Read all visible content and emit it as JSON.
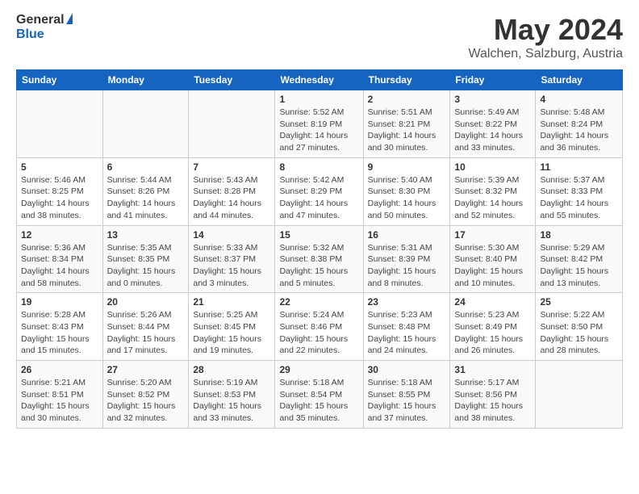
{
  "logo": {
    "general": "General",
    "blue": "Blue"
  },
  "title": "May 2024",
  "location": "Walchen, Salzburg, Austria",
  "weekdays": [
    "Sunday",
    "Monday",
    "Tuesday",
    "Wednesday",
    "Thursday",
    "Friday",
    "Saturday"
  ],
  "weeks": [
    [
      {
        "day": "",
        "info": ""
      },
      {
        "day": "",
        "info": ""
      },
      {
        "day": "",
        "info": ""
      },
      {
        "day": "1",
        "info": "Sunrise: 5:52 AM\nSunset: 8:19 PM\nDaylight: 14 hours and 27 minutes."
      },
      {
        "day": "2",
        "info": "Sunrise: 5:51 AM\nSunset: 8:21 PM\nDaylight: 14 hours and 30 minutes."
      },
      {
        "day": "3",
        "info": "Sunrise: 5:49 AM\nSunset: 8:22 PM\nDaylight: 14 hours and 33 minutes."
      },
      {
        "day": "4",
        "info": "Sunrise: 5:48 AM\nSunset: 8:24 PM\nDaylight: 14 hours and 36 minutes."
      }
    ],
    [
      {
        "day": "5",
        "info": "Sunrise: 5:46 AM\nSunset: 8:25 PM\nDaylight: 14 hours and 38 minutes."
      },
      {
        "day": "6",
        "info": "Sunrise: 5:44 AM\nSunset: 8:26 PM\nDaylight: 14 hours and 41 minutes."
      },
      {
        "day": "7",
        "info": "Sunrise: 5:43 AM\nSunset: 8:28 PM\nDaylight: 14 hours and 44 minutes."
      },
      {
        "day": "8",
        "info": "Sunrise: 5:42 AM\nSunset: 8:29 PM\nDaylight: 14 hours and 47 minutes."
      },
      {
        "day": "9",
        "info": "Sunrise: 5:40 AM\nSunset: 8:30 PM\nDaylight: 14 hours and 50 minutes."
      },
      {
        "day": "10",
        "info": "Sunrise: 5:39 AM\nSunset: 8:32 PM\nDaylight: 14 hours and 52 minutes."
      },
      {
        "day": "11",
        "info": "Sunrise: 5:37 AM\nSunset: 8:33 PM\nDaylight: 14 hours and 55 minutes."
      }
    ],
    [
      {
        "day": "12",
        "info": "Sunrise: 5:36 AM\nSunset: 8:34 PM\nDaylight: 14 hours and 58 minutes."
      },
      {
        "day": "13",
        "info": "Sunrise: 5:35 AM\nSunset: 8:35 PM\nDaylight: 15 hours and 0 minutes."
      },
      {
        "day": "14",
        "info": "Sunrise: 5:33 AM\nSunset: 8:37 PM\nDaylight: 15 hours and 3 minutes."
      },
      {
        "day": "15",
        "info": "Sunrise: 5:32 AM\nSunset: 8:38 PM\nDaylight: 15 hours and 5 minutes."
      },
      {
        "day": "16",
        "info": "Sunrise: 5:31 AM\nSunset: 8:39 PM\nDaylight: 15 hours and 8 minutes."
      },
      {
        "day": "17",
        "info": "Sunrise: 5:30 AM\nSunset: 8:40 PM\nDaylight: 15 hours and 10 minutes."
      },
      {
        "day": "18",
        "info": "Sunrise: 5:29 AM\nSunset: 8:42 PM\nDaylight: 15 hours and 13 minutes."
      }
    ],
    [
      {
        "day": "19",
        "info": "Sunrise: 5:28 AM\nSunset: 8:43 PM\nDaylight: 15 hours and 15 minutes."
      },
      {
        "day": "20",
        "info": "Sunrise: 5:26 AM\nSunset: 8:44 PM\nDaylight: 15 hours and 17 minutes."
      },
      {
        "day": "21",
        "info": "Sunrise: 5:25 AM\nSunset: 8:45 PM\nDaylight: 15 hours and 19 minutes."
      },
      {
        "day": "22",
        "info": "Sunrise: 5:24 AM\nSunset: 8:46 PM\nDaylight: 15 hours and 22 minutes."
      },
      {
        "day": "23",
        "info": "Sunrise: 5:23 AM\nSunset: 8:48 PM\nDaylight: 15 hours and 24 minutes."
      },
      {
        "day": "24",
        "info": "Sunrise: 5:23 AM\nSunset: 8:49 PM\nDaylight: 15 hours and 26 minutes."
      },
      {
        "day": "25",
        "info": "Sunrise: 5:22 AM\nSunset: 8:50 PM\nDaylight: 15 hours and 28 minutes."
      }
    ],
    [
      {
        "day": "26",
        "info": "Sunrise: 5:21 AM\nSunset: 8:51 PM\nDaylight: 15 hours and 30 minutes."
      },
      {
        "day": "27",
        "info": "Sunrise: 5:20 AM\nSunset: 8:52 PM\nDaylight: 15 hours and 32 minutes."
      },
      {
        "day": "28",
        "info": "Sunrise: 5:19 AM\nSunset: 8:53 PM\nDaylight: 15 hours and 33 minutes."
      },
      {
        "day": "29",
        "info": "Sunrise: 5:18 AM\nSunset: 8:54 PM\nDaylight: 15 hours and 35 minutes."
      },
      {
        "day": "30",
        "info": "Sunrise: 5:18 AM\nSunset: 8:55 PM\nDaylight: 15 hours and 37 minutes."
      },
      {
        "day": "31",
        "info": "Sunrise: 5:17 AM\nSunset: 8:56 PM\nDaylight: 15 hours and 38 minutes."
      },
      {
        "day": "",
        "info": ""
      }
    ]
  ]
}
